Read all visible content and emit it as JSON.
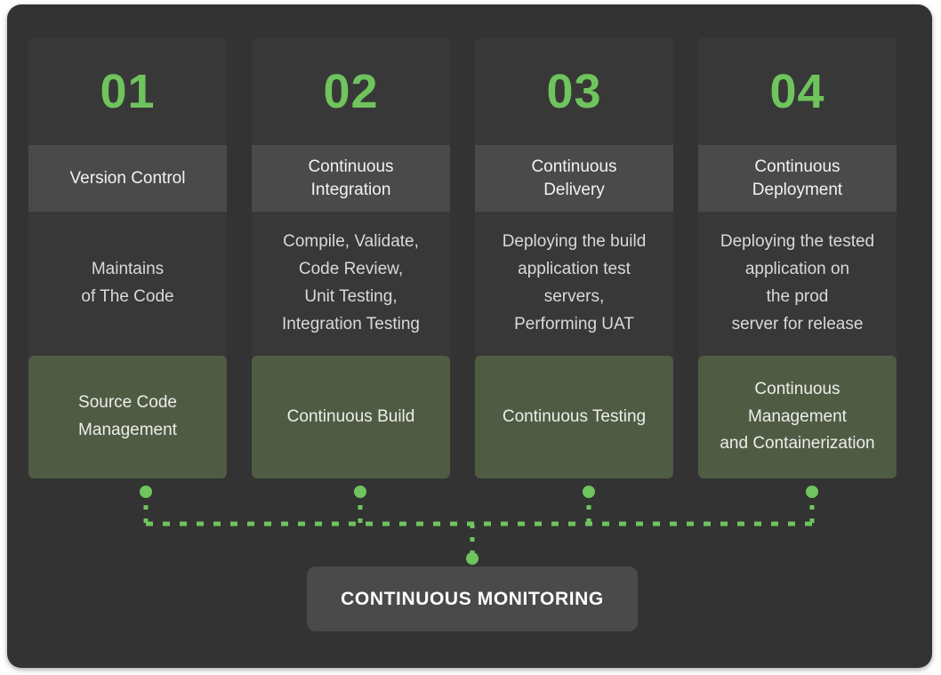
{
  "colors": {
    "page_background": "#ffffff",
    "panel_background": "#333333",
    "card_background": "#383838",
    "title_band": "#4a4a4a",
    "tool_band": "#505b44",
    "accent_green": "#6fc45e",
    "number_text": "#6fc45e",
    "title_text": "#f2f2f2",
    "desc_text": "#d9d9d9",
    "monitoring_background": "#4a4a4a",
    "monitoring_text": "#ffffff"
  },
  "diagram": {
    "type": "devops-pipeline-stages",
    "stages": [
      {
        "number": "01",
        "title": "Version Control",
        "description": "Maintains\nof The Code",
        "tool": "Source Code\nManagement"
      },
      {
        "number": "02",
        "title": "Continuous\nIntegration",
        "description": "Compile, Validate,\nCode Review,\nUnit Testing,\nIntegration Testing",
        "tool": "Continuous Build"
      },
      {
        "number": "03",
        "title": "Continuous\nDelivery",
        "description": "Deploying the build\napplication test\nservers,\nPerforming UAT",
        "tool": "Continuous Testing"
      },
      {
        "number": "04",
        "title": "Continuous\nDeployment",
        "description": "Deploying the tested\napplication on\nthe prod\nserver for release",
        "tool": "Continuous\nManagement\nand Containerization"
      }
    ],
    "footer": {
      "label": "CONTINUOUS MONITORING"
    },
    "connectors": {
      "style": "dotted",
      "color": "#6fc45e",
      "node_count": 5,
      "description": "Dotted green lines drop from each of the four stage tool boxes into a shared horizontal bus, which feeds down into the Continuous Monitoring bar."
    }
  }
}
